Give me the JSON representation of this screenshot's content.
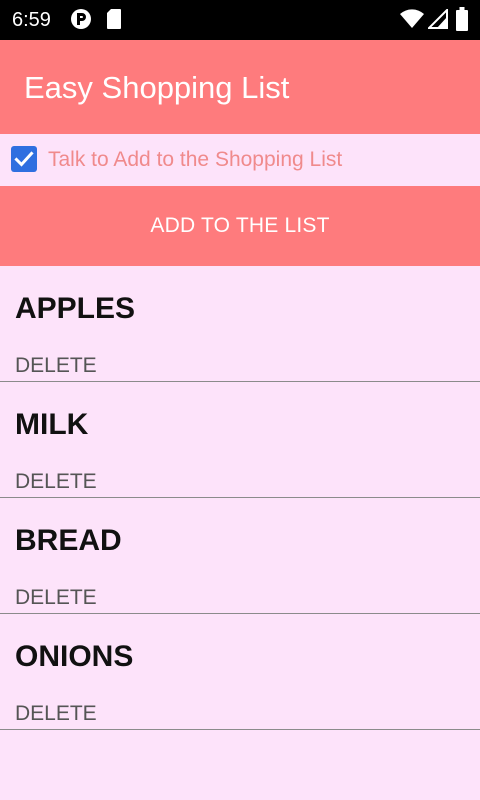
{
  "status_bar": {
    "time": "6:59",
    "icons": [
      "notification-app-icon",
      "sd-card-icon",
      "wifi-icon",
      "cell-signal-icon",
      "battery-icon"
    ]
  },
  "app_bar": {
    "title": "Easy Shopping List"
  },
  "talk_option": {
    "label": "Talk to Add to the Shopping List",
    "checked": true
  },
  "add_button": {
    "label": "ADD TO THE LIST"
  },
  "list": {
    "items": [
      {
        "name": "APPLES",
        "delete_label": "DELETE"
      },
      {
        "name": "MILK",
        "delete_label": "DELETE"
      },
      {
        "name": "BREAD",
        "delete_label": "DELETE"
      },
      {
        "name": "ONIONS",
        "delete_label": "DELETE"
      }
    ]
  },
  "colors": {
    "accent": "#fe7b7d",
    "background": "#fde3fa",
    "checkbox": "#2f6fe0",
    "checkbox_label": "#f08a8c",
    "status_bar": "#000000"
  }
}
